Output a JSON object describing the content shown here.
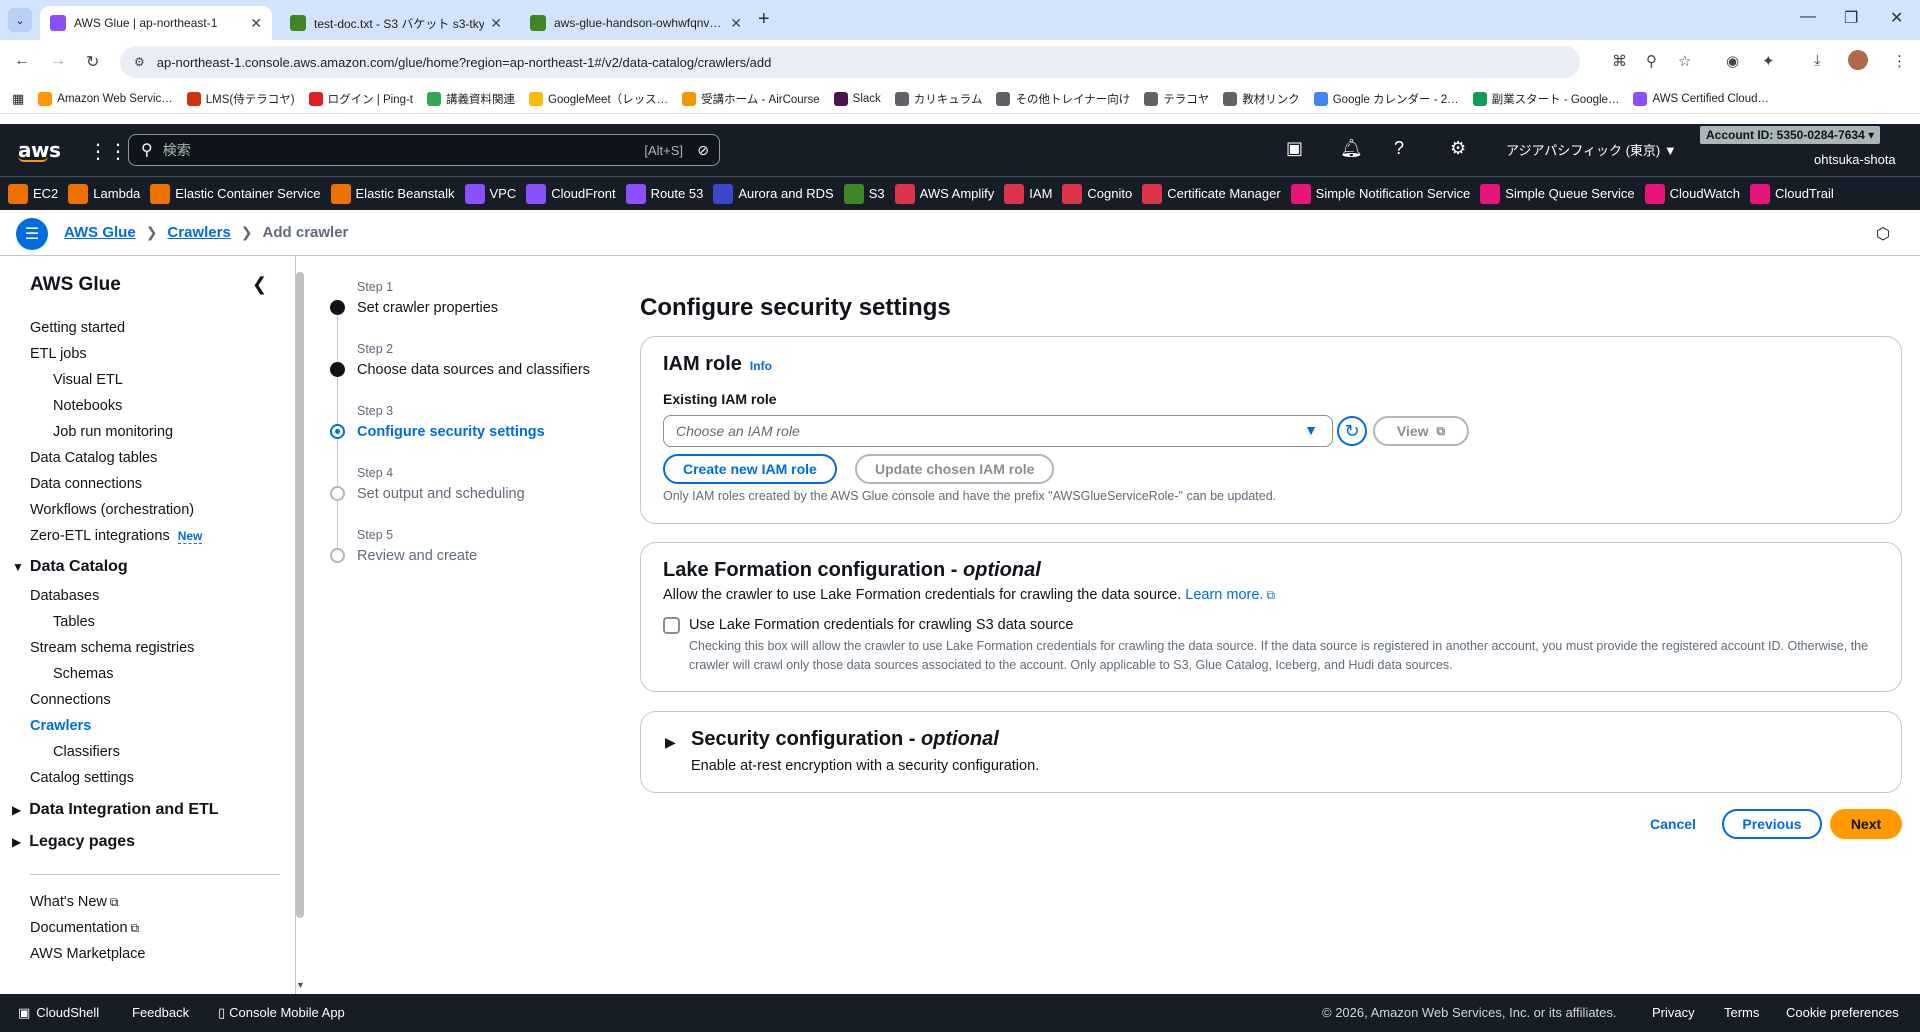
{
  "browser": {
    "tabs": [
      {
        "title": "AWS Glue | ap-northeast-1",
        "color": "#8c4fff"
      },
      {
        "title": "test-doc.txt - S3 バケット s3-tky-…",
        "color": "#3f8624"
      },
      {
        "title": "aws-glue-handson-owhwfqnv…",
        "color": "#3f8624"
      }
    ],
    "url": "ap-northeast-1.console.aws.amazon.com/glue/home?region=ap-northeast-1#/v2/data-catalog/crawlers/add",
    "bookmarks": [
      {
        "label": "Amazon Web Servic…",
        "color": "#ff9900"
      },
      {
        "label": "LMS(侍テラコヤ)",
        "color": "#d13212"
      },
      {
        "label": "ログイン | Ping-t",
        "color": "#e02020"
      },
      {
        "label": "講義資料関連",
        "color": "#34a853"
      },
      {
        "label": "GoogleMeet（レッス…",
        "color": "#fbbc05"
      },
      {
        "label": "受講ホーム - AirCourse",
        "color": "#f29900"
      },
      {
        "label": "Slack",
        "color": "#4a154b"
      },
      {
        "label": "カリキュラム",
        "color": "#5f6368"
      },
      {
        "label": "その他トレイナー向け",
        "color": "#5f6368"
      },
      {
        "label": "テラコヤ",
        "color": "#5f6368"
      },
      {
        "label": "教材リンク",
        "color": "#5f6368"
      },
      {
        "label": "Google カレンダー - 2…",
        "color": "#4285f4"
      },
      {
        "label": "副業スタート - Google…",
        "color": "#0f9d58"
      },
      {
        "label": "AWS Certified Cloud…",
        "color": "#8c4fff"
      }
    ]
  },
  "aws_header": {
    "logo": "aws",
    "search_placeholder": "検索",
    "search_shortcut": "[Alt+S]",
    "region": "アジアパシフィック (東京) ▼",
    "account": "Account ID: 5350-0284-7634 ▾",
    "user": "ohtsuka-shota"
  },
  "services": [
    {
      "label": "EC2",
      "color": "#ed7100"
    },
    {
      "label": "Lambda",
      "color": "#ed7100"
    },
    {
      "label": "Elastic Container Service",
      "color": "#ed7100"
    },
    {
      "label": "Elastic Beanstalk",
      "color": "#ed7100"
    },
    {
      "label": "VPC",
      "color": "#8c4fff"
    },
    {
      "label": "CloudFront",
      "color": "#8c4fff"
    },
    {
      "label": "Route 53",
      "color": "#8c4fff"
    },
    {
      "label": "Aurora and RDS",
      "color": "#3b48cc"
    },
    {
      "label": "S3",
      "color": "#3f8624"
    },
    {
      "label": "AWS Amplify",
      "color": "#dd344c"
    },
    {
      "label": "IAM",
      "color": "#dd344c"
    },
    {
      "label": "Cognito",
      "color": "#dd344c"
    },
    {
      "label": "Certificate Manager",
      "color": "#dd344c"
    },
    {
      "label": "Simple Notification Service",
      "color": "#e7157b"
    },
    {
      "label": "Simple Queue Service",
      "color": "#e7157b"
    },
    {
      "label": "CloudWatch",
      "color": "#e7157b"
    },
    {
      "label": "CloudTrail",
      "color": "#e7157b"
    }
  ],
  "breadcrumb": {
    "items": [
      "AWS Glue",
      "Crawlers"
    ],
    "current": "Add crawler"
  },
  "sidenav": {
    "title": "AWS Glue",
    "items": [
      {
        "label": "Getting started"
      },
      {
        "label": "ETL jobs"
      },
      {
        "label": "Visual ETL"
      },
      {
        "label": "Notebooks"
      },
      {
        "label": "Job run monitoring"
      },
      {
        "label": "Data Catalog tables"
      },
      {
        "label": "Data connections"
      },
      {
        "label": "Workflows (orchestration)"
      },
      {
        "label": "Zero-ETL integrations",
        "badge": "New"
      },
      {
        "label": "Data Catalog"
      },
      {
        "label": "Databases"
      },
      {
        "label": "Tables"
      },
      {
        "label": "Stream schema registries"
      },
      {
        "label": "Schemas"
      },
      {
        "label": "Connections"
      },
      {
        "label": "Crawlers"
      },
      {
        "label": "Classifiers"
      },
      {
        "label": "Catalog settings"
      },
      {
        "label": "Data Integration and ETL"
      },
      {
        "label": "Legacy pages"
      },
      {
        "label": "What's New"
      },
      {
        "label": "Documentation"
      },
      {
        "label": "AWS Marketplace"
      }
    ]
  },
  "wizard": {
    "steps": [
      {
        "num": "Step 1",
        "label": "Set crawler properties"
      },
      {
        "num": "Step 2",
        "label": "Choose data sources and classifiers"
      },
      {
        "num": "Step 3",
        "label": "Configure security settings"
      },
      {
        "num": "Step 4",
        "label": "Set output and scheduling"
      },
      {
        "num": "Step 5",
        "label": "Review and create"
      }
    ]
  },
  "main": {
    "title": "Configure security settings",
    "iam": {
      "title": "IAM role",
      "info": "Info",
      "label": "Existing IAM role",
      "placeholder": "Choose an IAM role",
      "view_btn": "View",
      "create_btn": "Create new IAM role",
      "update_btn": "Update chosen IAM role",
      "hint": "Only IAM roles created by the AWS Glue console and have the prefix \"AWSGlueServiceRole-\" can be updated."
    },
    "lake": {
      "title": "Lake Formation configuration - ",
      "title_opt": "optional",
      "desc": "Allow the crawler to use Lake Formation credentials for crawling the data source. ",
      "learn_more": "Learn more.",
      "checkbox_label": "Use Lake Formation credentials for crawling S3 data source",
      "checkbox_desc": "Checking this box will allow the crawler to use Lake Formation credentials for crawling the data source. If the data source is registered in another account, you must provide the registered account ID. Otherwise, the crawler will crawl only those data sources associated to the account. Only applicable to S3, Glue Catalog, Iceberg, and Hudi data sources."
    },
    "security": {
      "title": "Security configuration - ",
      "title_opt": "optional",
      "desc": "Enable at-rest encryption with a security configuration."
    },
    "actions": {
      "cancel": "Cancel",
      "previous": "Previous",
      "next": "Next"
    }
  },
  "footer": {
    "cloudshell": "CloudShell",
    "feedback": "Feedback",
    "mobile": "Console Mobile App",
    "copyright": "© 2026, Amazon Web Services, Inc. or its affiliates.",
    "privacy": "Privacy",
    "terms": "Terms",
    "cookies": "Cookie preferences"
  }
}
